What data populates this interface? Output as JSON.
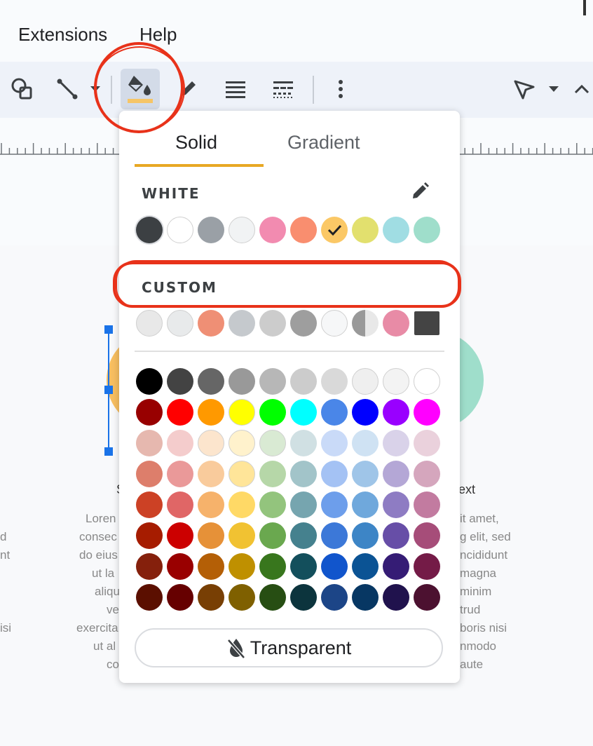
{
  "menu": {
    "extensions": "Extensions",
    "help": "Help"
  },
  "toolbar": {
    "icons": [
      "shapes-icon",
      "line-icon",
      "line-dropdown-icon",
      "fill-color-icon",
      "border-color-icon",
      "border-weight-icon",
      "border-dash-icon",
      "more-options-icon",
      "select-icon",
      "select-dropdown-icon",
      "collapse-icon"
    ],
    "fill_underline_color": "#f6c566"
  },
  "popup": {
    "tabs": {
      "solid": "Solid",
      "gradient": "Gradient"
    },
    "current_color_label": "WHITE",
    "custom_label": "CUSTOM",
    "transparent_label": "Transparent",
    "theme_colors": [
      "#3c4043",
      "#ffffff",
      "#9aa0a6",
      "#f1f3f4",
      "#f28bb0",
      "#f98e6f",
      "#fbc866",
      "#e2e06e",
      "#a0dde3",
      "#9fdecb"
    ],
    "theme_selected_index": 6,
    "custom_colors": [
      "#e8e8e8",
      "#e8eaeb",
      "#ef8f75",
      "#c5c9cd",
      "#cccccc",
      "#9e9e9e",
      "#f6f7f8",
      "#999999",
      "#e88ba6",
      "#444444"
    ],
    "palette": [
      [
        "#000000",
        "#434343",
        "#666666",
        "#999999",
        "#b7b7b7",
        "#cccccc",
        "#d9d9d9",
        "#efefef",
        "#f3f3f3",
        "#ffffff"
      ],
      [
        "#980000",
        "#ff0000",
        "#ff9900",
        "#ffff00",
        "#00ff00",
        "#00ffff",
        "#4a86e8",
        "#0000ff",
        "#9900ff",
        "#ff00ff"
      ],
      [
        "#e6b8af",
        "#f4cccc",
        "#fce5cd",
        "#fff2cc",
        "#d9ead3",
        "#d0e0e3",
        "#c9daf8",
        "#cfe2f3",
        "#d9d2e9",
        "#ead1dc"
      ],
      [
        "#dd7e6b",
        "#ea9999",
        "#f9cb9c",
        "#ffe599",
        "#b6d7a8",
        "#a2c4c9",
        "#a4c2f4",
        "#9fc5e8",
        "#b4a7d6",
        "#d5a6bd"
      ],
      [
        "#cc4125",
        "#e06666",
        "#f6b26b",
        "#ffd966",
        "#93c47d",
        "#76a5af",
        "#6d9eeb",
        "#6fa8dc",
        "#8e7cc3",
        "#c27ba0"
      ],
      [
        "#a61c00",
        "#cc0000",
        "#e69138",
        "#f1c232",
        "#6aa84f",
        "#45818e",
        "#3c78d8",
        "#3d85c6",
        "#674ea7",
        "#a64d79"
      ],
      [
        "#85200c",
        "#990000",
        "#b45f06",
        "#bf9000",
        "#38761d",
        "#134f5c",
        "#1155cc",
        "#0b5394",
        "#351c75",
        "#741b47"
      ],
      [
        "#5b0f00",
        "#660000",
        "#783f04",
        "#7f6000",
        "#274e13",
        "#0c343d",
        "#1c4587",
        "#073763",
        "#20124d",
        "#4c1130"
      ]
    ]
  },
  "canvas": {
    "left_col": [
      "d",
      "nt",
      "isi"
    ],
    "mid_col_title": "S",
    "mid_col": [
      "Loren",
      "consec",
      "do eius",
      "ut la",
      "aliqu",
      "ve",
      "exercita",
      "ut al",
      "co"
    ],
    "right_col_title": "ext",
    "right_col": [
      "it amet,",
      "g elit, sed",
      "ncididunt",
      "magna",
      "minim",
      "trud",
      "boris nisi",
      "nmodo",
      "aute"
    ],
    "shape_colors": {
      "left": "#f7be60",
      "right": "#9fdecb"
    }
  },
  "annotations": {
    "color": "#e8321a"
  }
}
